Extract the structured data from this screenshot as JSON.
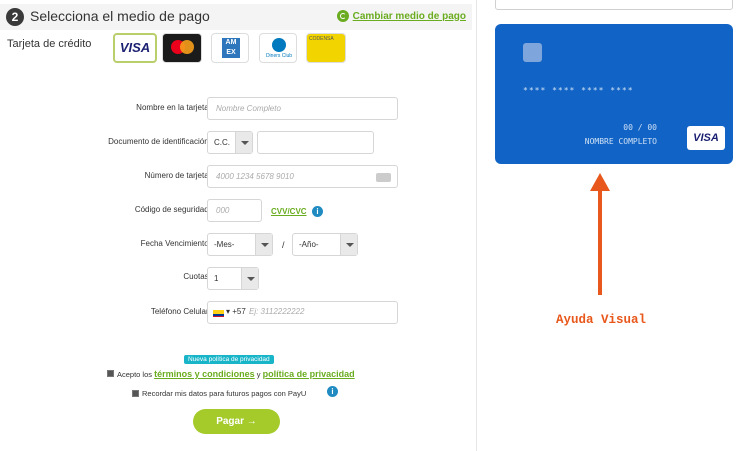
{
  "header": {
    "step_number": "2",
    "title": "Selecciona el medio de pago",
    "change_link": "Cambiar medio de pago"
  },
  "payment_method": {
    "label": "Tarjeta de crédito",
    "brands": [
      {
        "name": "VISA",
        "icon": "visa-logo"
      },
      {
        "name": "Mastercard",
        "icon": "mastercard-logo"
      },
      {
        "name": "AM EX",
        "icon": "amex-logo"
      },
      {
        "name": "Diners Club",
        "icon": "diners-logo"
      },
      {
        "name": "CODENSA",
        "icon": "codensa-logo"
      }
    ]
  },
  "form": {
    "name_label": "Nombre en la tarjeta *",
    "name_placeholder": "Nombre Completo",
    "document_label": "Documento de identificación *",
    "document_type": "C.C.",
    "card_number_label": "Número de tarjeta *",
    "card_number_placeholder": "4000 1234 5678 9010",
    "security_label": "Código de seguridad *",
    "security_placeholder": "000",
    "cvv_link": "CVV/CVC",
    "expiry_label": "Fecha Vencimiento *",
    "month_select": "-Mes-",
    "separator": "/",
    "year_select": "-Año-",
    "installments_label": "Cuotas *",
    "installments_value": "1",
    "phone_label": "Teléfono Celular *",
    "phone_prefix": "+57",
    "phone_placeholder": "Ej: 3112222222"
  },
  "privacy": {
    "badge": "Nueva política de privacidad",
    "accept_prefix": "Acepto los",
    "terms_link": "términos y condiciones",
    "and": "y",
    "policy_link": "política de privacidad",
    "remember": "Recordar mis datos para futuros pagos con PayU"
  },
  "pay_button": "Pagar →",
  "card_preview": {
    "number": "**** **** **** ****",
    "expiry": "00 / 00",
    "name": "NOMBRE COMPLETO",
    "brand": "VISA"
  },
  "annotation": {
    "text": "Ayuda Visual",
    "color": "#e8571b"
  },
  "colors": {
    "accent_green": "#a4cb2a",
    "link_green": "#6aac1f",
    "card_blue": "#1164c6"
  }
}
